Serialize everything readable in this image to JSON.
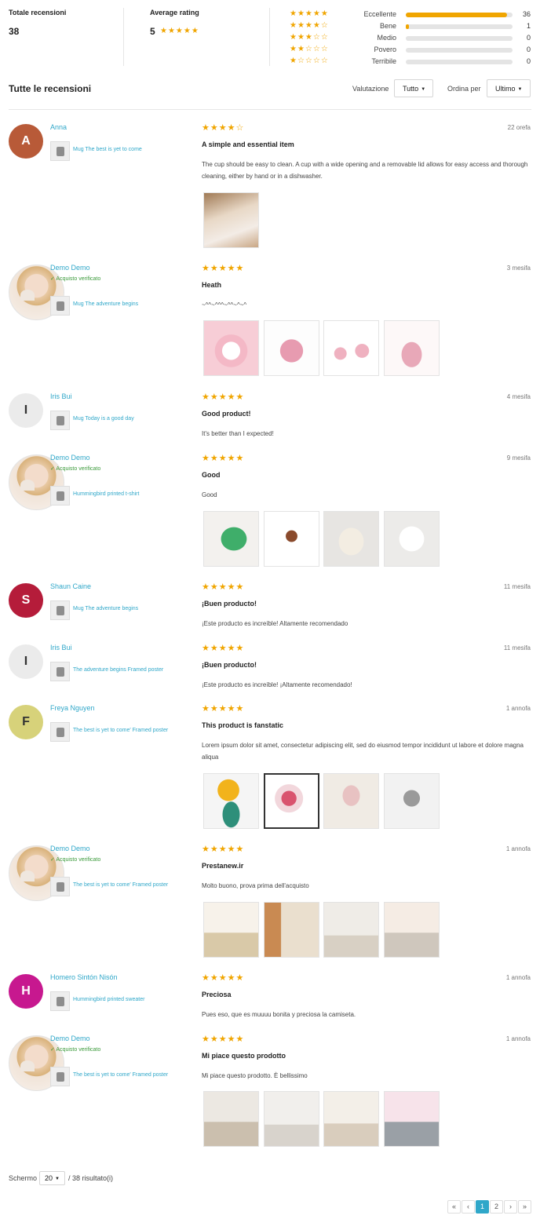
{
  "summary": {
    "total_label": "Totale recensioni",
    "total_value": "38",
    "avg_label": "Average rating",
    "avg_value": "5",
    "avg_stars": "★★★★★",
    "distribution": [
      {
        "stars": "★★★★★",
        "label": "Eccellente",
        "count": "36",
        "fraction": 0.95
      },
      {
        "stars": "★★★★☆",
        "label": "Bene",
        "count": "1",
        "fraction": 0.03
      },
      {
        "stars": "★★★☆☆",
        "label": "Medio",
        "count": "0",
        "fraction": 0
      },
      {
        "stars": "★★☆☆☆",
        "label": "Povero",
        "count": "0",
        "fraction": 0
      },
      {
        "stars": "★☆☆☆☆",
        "label": "Terribile",
        "count": "0",
        "fraction": 0
      }
    ]
  },
  "toolbar": {
    "title": "Tutte le recensioni",
    "rating_label": "Valutazione",
    "rating_value": "Tutto",
    "sort_label": "Ordina per",
    "sort_value": "Ultimo"
  },
  "colors": {
    "accent": "#2fa7c9",
    "star": "#f0a500",
    "verified": "#3a9a3a"
  },
  "reviews": [
    {
      "name": "Anna",
      "initial": "A",
      "avatar_color": "#b85a38",
      "verified": "",
      "product": "Mug The best is yet to come",
      "stars": "★★★★☆",
      "date": "22 orefa",
      "title": "A simple and essential item",
      "body": "The cup should be easy to clean. A cup with a wide opening and a removable lid allows for easy access and thorough cleaning, either by hand or in a dishwasher."
    },
    {
      "name": "Demo Demo",
      "initial": "",
      "avatar_color": "",
      "verified": "✓ Acquisto verificato",
      "product": "Mug The adventure begins",
      "stars": "★★★★★",
      "date": "3 mesifa",
      "title": "Heath",
      "body": "~^^~^^^~^^~^~^"
    },
    {
      "name": "Iris Bui",
      "initial": "I",
      "avatar_color": "#ebebeb",
      "verified": "",
      "product": "Mug Today is a good day",
      "stars": "★★★★★",
      "date": "4 mesifa",
      "title": "Good product!",
      "body": "It's better than I expected!"
    },
    {
      "name": "Demo Demo",
      "initial": "",
      "avatar_color": "",
      "verified": "✓ Acquisto verificato",
      "product": "Hummingbird printed t-shirt",
      "stars": "★★★★★",
      "date": "9 mesifa",
      "title": "Good",
      "body": "Good"
    },
    {
      "name": "Shaun Caine",
      "initial": "S",
      "avatar_color": "#b51c3a",
      "verified": "",
      "product": "Mug The adventure begins",
      "stars": "★★★★★",
      "date": "11 mesifa",
      "title": "¡Buen producto!",
      "body": "¡Este producto es increíble! Altamente recomendado"
    },
    {
      "name": "Iris Bui",
      "initial": "I",
      "avatar_color": "#ebebeb",
      "verified": "",
      "product": "The adventure begins Framed poster",
      "stars": "★★★★★",
      "date": "11 mesifa",
      "title": "¡Buen producto!",
      "body": "¡Este producto es increíble! ¡Altamente recomendado!"
    },
    {
      "name": "Freya Nguyen",
      "initial": "F",
      "avatar_color": "#d7d27a",
      "verified": "",
      "product": "The best is yet to come' Framed poster",
      "stars": "★★★★★",
      "date": "1 annofa",
      "title": "This product is fanstatic",
      "body": "Lorem ipsum dolor sit amet, consectetur adipiscing elit, sed do eiusmod tempor incididunt ut labore et dolore magna aliqua"
    },
    {
      "name": "Demo Demo",
      "initial": "",
      "avatar_color": "",
      "verified": "✓ Acquisto verificato",
      "product": "The best is yet to come' Framed poster",
      "stars": "★★★★★",
      "date": "1 annofa",
      "title": "Prestanew.ir",
      "body": "Molto buono, prova prima dell'acquisto"
    },
    {
      "name": "Homero Sintón Nisón",
      "initial": "H",
      "avatar_color": "#c7188f",
      "verified": "",
      "product": "Hummingbird printed sweater",
      "stars": "★★★★★",
      "date": "1 annofa",
      "title": "Preciosa",
      "body": "Pues eso, que es muuuu bonita y preciosa la camiseta."
    },
    {
      "name": "Demo Demo",
      "initial": "",
      "avatar_color": "",
      "verified": "✓ Acquisto verificato",
      "product": "The best is yet to come' Framed poster",
      "stars": "★★★★★",
      "date": "1 annofa",
      "title": "Mi piace questo prodotto",
      "body": "Mi piace questo prodotto. È bellissimo"
    }
  ],
  "footer": {
    "show_label": "Schermo",
    "per_page": "20",
    "results": "/ 38 risultato(i)",
    "pages": [
      "«",
      "‹",
      "1",
      "2",
      "›",
      "»"
    ]
  }
}
